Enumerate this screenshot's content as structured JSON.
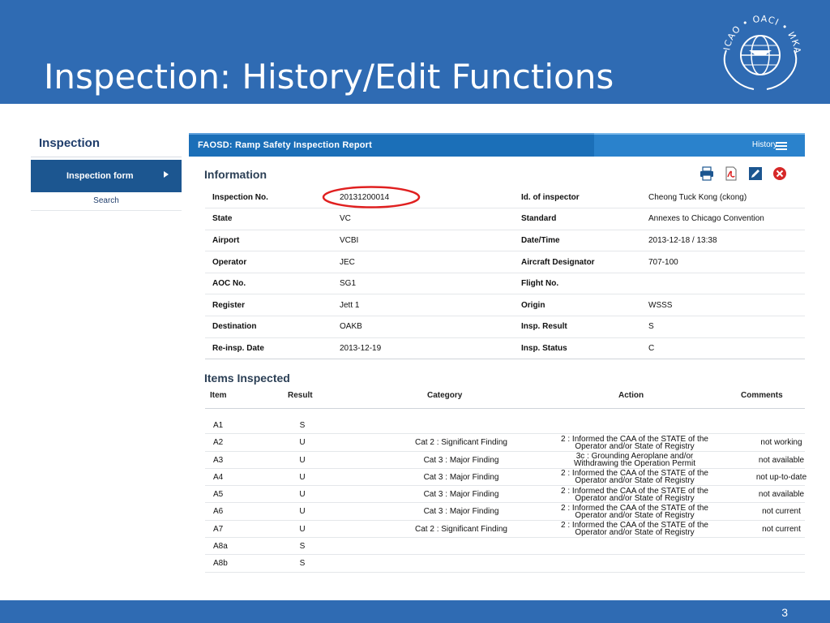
{
  "slide": {
    "title": "Inspection: History/Edit Functions",
    "page_number": "3",
    "colors": {
      "header": "#2f6bb3",
      "panel_bar": "#1b6fb8",
      "highlight": "#e02020"
    }
  },
  "logo": {
    "text": "ICAO • OACI • ИКАО",
    "icon": "icao-emblem-icon"
  },
  "sidebar": {
    "title": "Inspection",
    "active_item": "Inspection form",
    "items": [
      {
        "label": "Search"
      }
    ]
  },
  "panel": {
    "title": "FAOSD: Ramp Safety Inspection Report",
    "history_label": "History",
    "info_title": "Information",
    "toolbar": [
      "print-icon",
      "pdf-icon",
      "edit-icon",
      "delete-icon"
    ],
    "info_rows": [
      {
        "l1": "Inspection No.",
        "v1": "20131200014",
        "l2": "Id. of inspector",
        "v2": "Cheong Tuck Kong (ckong)"
      },
      {
        "l1": "State",
        "v1": "VC",
        "l2": "Standard",
        "v2": "Annexes to Chicago Convention"
      },
      {
        "l1": "Airport",
        "v1": "VCBI",
        "l2": "Date/Time",
        "v2": "2013-12-18 / 13:38"
      },
      {
        "l1": "Operator",
        "v1": "JEC",
        "l2": "Aircraft Designator",
        "v2": "707-100"
      },
      {
        "l1": "AOC No.",
        "v1": "SG1",
        "l2": "Flight No.",
        "v2": ""
      },
      {
        "l1": "Register",
        "v1": "Jett 1",
        "l2": "Origin",
        "v2": "WSSS"
      },
      {
        "l1": "Destination",
        "v1": "OAKB",
        "l2": "Insp. Result",
        "v2": "S"
      },
      {
        "l1": "Re-insp. Date",
        "v1": "2013-12-19",
        "l2": "Insp. Status",
        "v2": "C"
      }
    ],
    "items_title": "Items Inspected",
    "items_headers": {
      "item": "Item",
      "result": "Result",
      "category": "Category",
      "action": "Action",
      "comments": "Comments"
    },
    "items": [
      {
        "item": "A1",
        "result": "S",
        "category": "",
        "action1": "",
        "action2": "",
        "comments": ""
      },
      {
        "item": "A2",
        "result": "U",
        "category": "Cat 2 : Significant Finding",
        "action1": "2 : Informed the CAA of the STATE of the",
        "action2": "Operator and/or State of Registry",
        "comments": "not working"
      },
      {
        "item": "A3",
        "result": "U",
        "category": "Cat 3 : Major Finding",
        "action1": "3c : Grounding Aeroplane and/or",
        "action2": "Withdrawing the Operation Permit",
        "comments": "not available"
      },
      {
        "item": "A4",
        "result": "U",
        "category": "Cat 3 : Major Finding",
        "action1": "2 : Informed the CAA of the STATE of the",
        "action2": "Operator and/or State of Registry",
        "comments": "not up-to-date"
      },
      {
        "item": "A5",
        "result": "U",
        "category": "Cat 3 : Major Finding",
        "action1": "2 : Informed the CAA of the STATE of the",
        "action2": "Operator and/or State of Registry",
        "comments": "not available"
      },
      {
        "item": "A6",
        "result": "U",
        "category": "Cat 3 : Major Finding",
        "action1": "2 : Informed the CAA of the STATE of the",
        "action2": "Operator and/or State of Registry",
        "comments": "not current"
      },
      {
        "item": "A7",
        "result": "U",
        "category": "Cat 2 : Significant Finding",
        "action1": "2 : Informed the CAA of the STATE of the",
        "action2": "Operator and/or State of Registry",
        "comments": "not current"
      },
      {
        "item": "A8a",
        "result": "S",
        "category": "",
        "action1": "",
        "action2": "",
        "comments": ""
      },
      {
        "item": "A8b",
        "result": "S",
        "category": "",
        "action1": "",
        "action2": "",
        "comments": ""
      }
    ]
  }
}
